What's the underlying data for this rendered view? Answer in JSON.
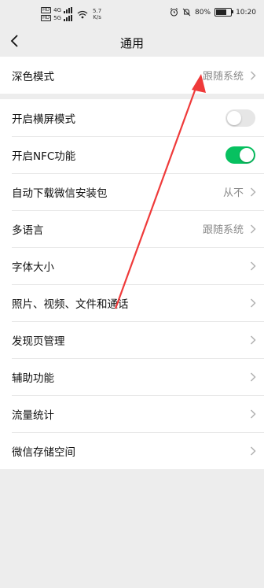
{
  "status_bar": {
    "sim1_label": "HD",
    "sim1_network": "4G",
    "sim2_label": "HD",
    "sim2_network": "5G",
    "net_speed_value": "5.7",
    "net_speed_unit": "K/s",
    "battery_text": "80%",
    "battery_level": 0.8,
    "time": "10:20"
  },
  "header": {
    "title": "通用"
  },
  "group1": [
    {
      "label": "深色模式",
      "value": "跟随系统"
    }
  ],
  "group2": [
    {
      "label": "开启横屏模式",
      "toggle": "off"
    },
    {
      "label": "开启NFC功能",
      "toggle": "on"
    },
    {
      "label": "自动下载微信安装包",
      "value": "从不"
    },
    {
      "label": "多语言",
      "value": "跟随系统"
    },
    {
      "label": "字体大小",
      "value": ""
    },
    {
      "label": "照片、视频、文件和通话",
      "value": ""
    },
    {
      "label": "发现页管理",
      "value": ""
    },
    {
      "label": "辅助功能",
      "value": ""
    },
    {
      "label": "流量统计",
      "value": ""
    },
    {
      "label": "微信存储空间",
      "value": ""
    }
  ],
  "colors": {
    "toggle_on": "#07c160",
    "annotation_arrow": "#ef3a3a",
    "background": "#ededed"
  }
}
